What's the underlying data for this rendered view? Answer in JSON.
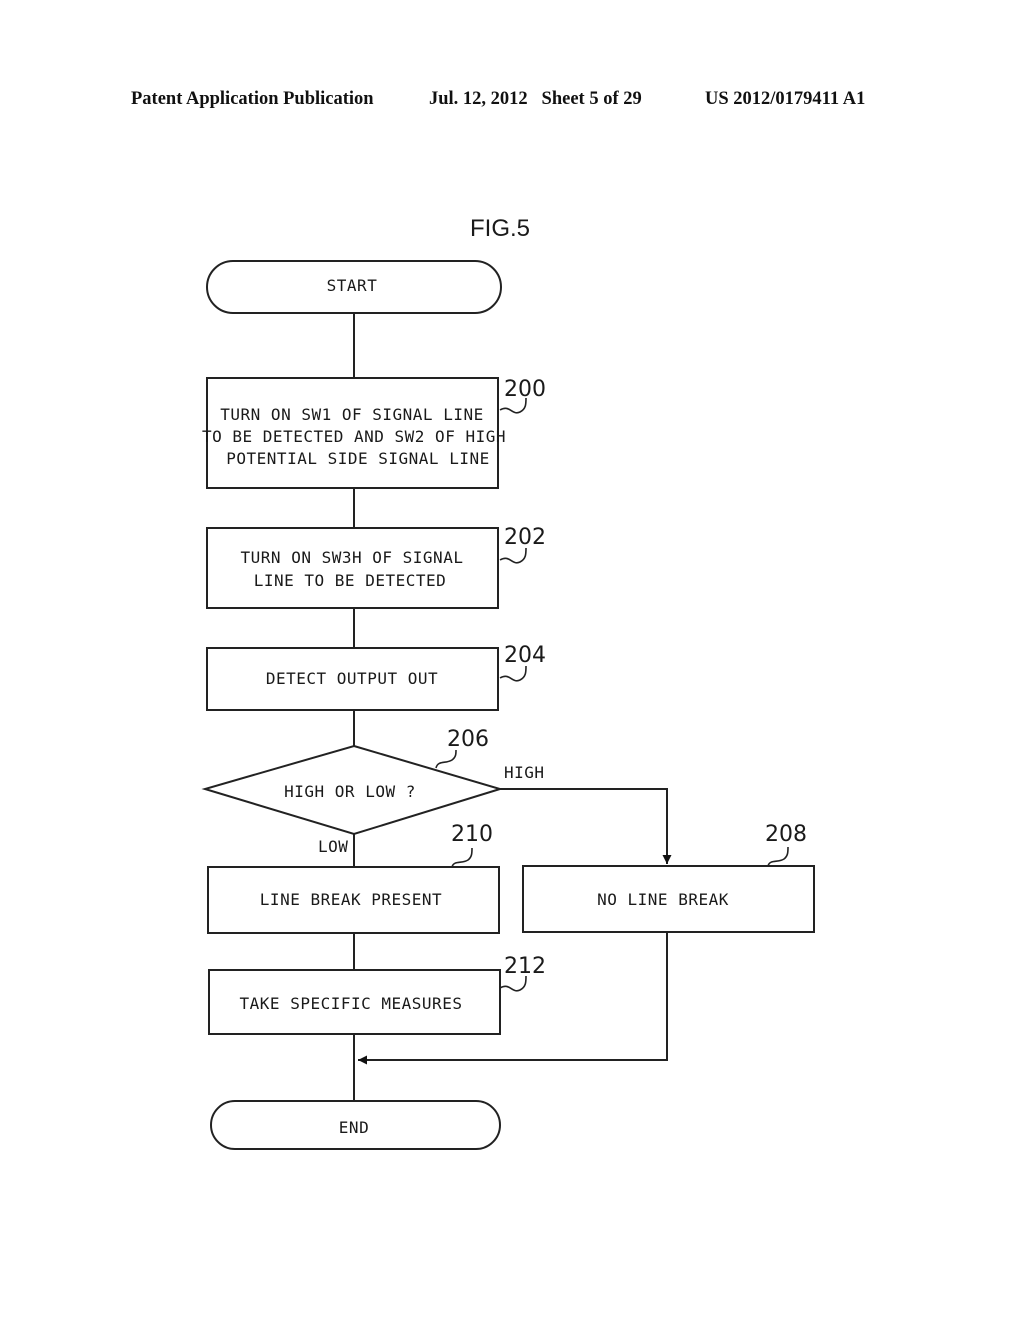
{
  "header": {
    "publication": "Patent Application Publication",
    "date_sheet": "Jul. 12, 2012   Sheet 5 of 29",
    "number": "US 2012/0179411 A1"
  },
  "figure": {
    "title": "FIG.5",
    "start": "START",
    "end": "END",
    "steps": {
      "s200": {
        "ref": "200",
        "lines": [
          "TURN ON SW1 OF SIGNAL LINE",
          "TO BE DETECTED AND SW2 OF HIGH",
          "POTENTIAL SIDE SIGNAL LINE"
        ]
      },
      "s202": {
        "ref": "202",
        "lines": [
          "TURN ON SW3H OF SIGNAL",
          "LINE TO BE DETECTED"
        ]
      },
      "s204": {
        "ref": "204",
        "lines": [
          "DETECT OUTPUT OUT"
        ]
      },
      "s206": {
        "ref": "206",
        "lines": [
          "HIGH OR LOW ?"
        ],
        "branch_high": "HIGH",
        "branch_low": "LOW"
      },
      "s208": {
        "ref": "208",
        "lines": [
          "NO LINE BREAK"
        ]
      },
      "s210": {
        "ref": "210",
        "lines": [
          "LINE BREAK PRESENT"
        ]
      },
      "s212": {
        "ref": "212",
        "lines": [
          "TAKE SPECIFIC MEASURES"
        ]
      }
    }
  }
}
